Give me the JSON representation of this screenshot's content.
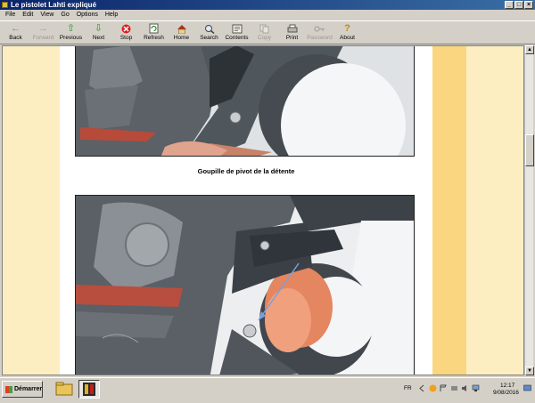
{
  "window": {
    "title": "Le pistolet Lahti expliqué"
  },
  "menu": [
    "File",
    "Edit",
    "View",
    "Go",
    "Options",
    "Help"
  ],
  "toolbar": [
    {
      "label": "Back",
      "icon": "back-arrow-icon",
      "enabled": true
    },
    {
      "label": "Forward",
      "icon": "forward-arrow-icon",
      "enabled": false
    },
    {
      "label": "Previous",
      "icon": "up-arrow-icon",
      "enabled": true
    },
    {
      "label": "Next",
      "icon": "down-arrow-icon",
      "enabled": true
    },
    {
      "label": "Stop",
      "icon": "stop-icon",
      "enabled": true
    },
    {
      "label": "Refresh",
      "icon": "refresh-icon",
      "enabled": true
    },
    {
      "label": "Home",
      "icon": "home-icon",
      "enabled": true
    },
    {
      "label": "Search",
      "icon": "search-icon",
      "enabled": true
    },
    {
      "label": "Contents",
      "icon": "contents-icon",
      "enabled": true
    },
    {
      "label": "Copy",
      "icon": "copy-icon",
      "enabled": false
    },
    {
      "label": "Print",
      "icon": "print-icon",
      "enabled": true
    },
    {
      "label": "Password",
      "icon": "key-icon",
      "enabled": false
    },
    {
      "label": "About",
      "icon": "about-icon",
      "enabled": true
    }
  ],
  "content": {
    "caption1": "Goupille de pivot de la détente"
  },
  "taskbar": {
    "start_label": "Démarrer",
    "language": "FR",
    "time": "12:17",
    "date": "9/08/2016"
  },
  "colors": {
    "page_background": "#fdeec2",
    "gold_strip": "#fbd681",
    "title_bar": "#0a246a",
    "arrow_annotation": "#7a9fe0"
  }
}
